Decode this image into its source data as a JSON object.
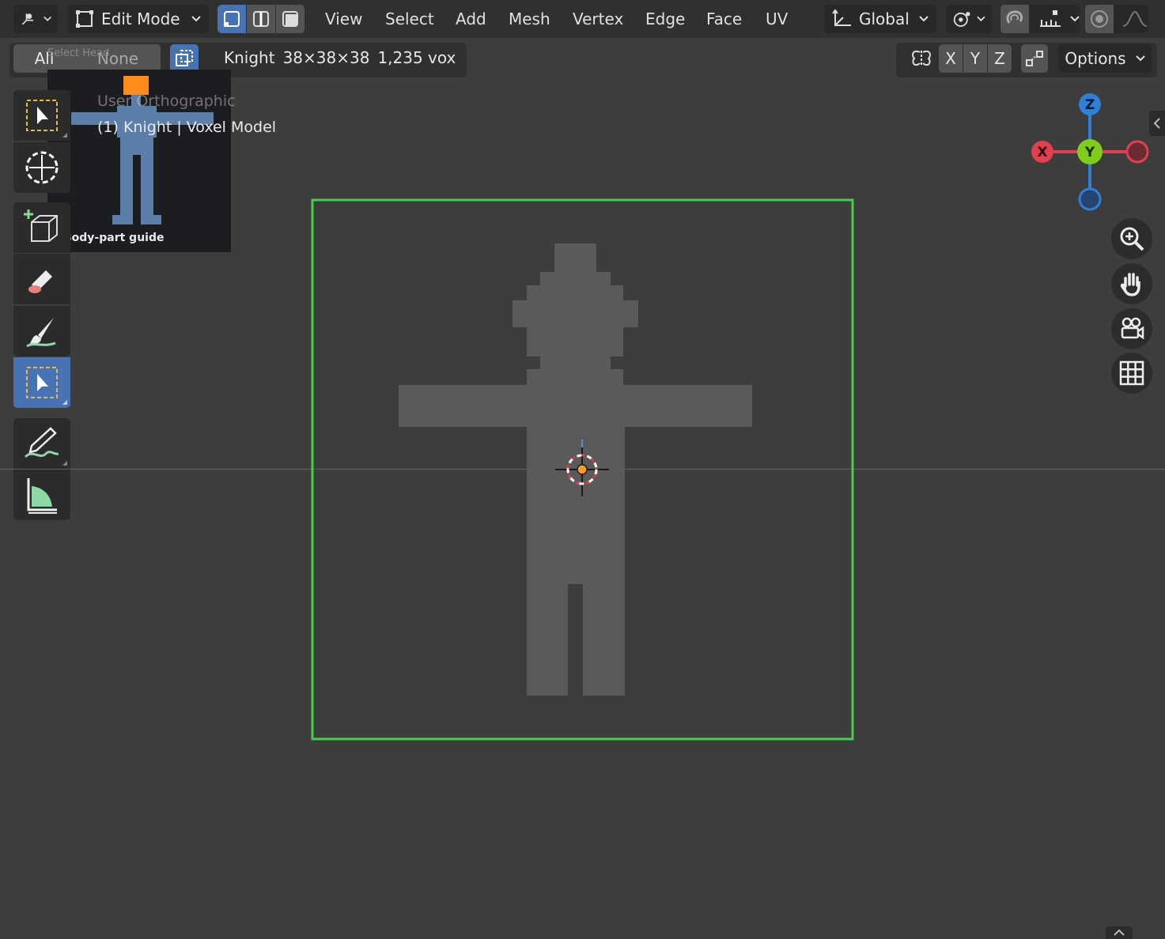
{
  "header": {
    "mode_label": "Edit Mode",
    "menus": [
      "View",
      "Select",
      "Add",
      "Mesh",
      "Vertex",
      "Edge",
      "Face",
      "UV"
    ],
    "orientation_label": "Global"
  },
  "topbar": {
    "all_label": "All",
    "none_label": "None",
    "object_name": "Knight",
    "dimensions": "38×38×38",
    "voxel_count": "1,235 vox",
    "axes": [
      "X",
      "Y",
      "Z"
    ],
    "options_label": "Options"
  },
  "overlay": {
    "view_name": "User Orthographic",
    "collection_text": "(1) Knight | Voxel Model",
    "hint_prefix": "Select Head"
  },
  "guide": {
    "caption": "Body-part guide",
    "highlight_color": "#ff8c1a",
    "figure_color": "#5b7fa8"
  },
  "gizmo": {
    "z_label": "Z",
    "x_label": "X",
    "y_label": "Y",
    "z_color": "#2f7fd6",
    "x_color": "#e04050",
    "y_color": "#7fcc1a"
  },
  "selection_box_color": "#44d04e",
  "tools": [
    "select-box",
    "cursor",
    "add-cube",
    "eraser",
    "paint-brush",
    "select-box-active",
    "annotate",
    "measure"
  ]
}
